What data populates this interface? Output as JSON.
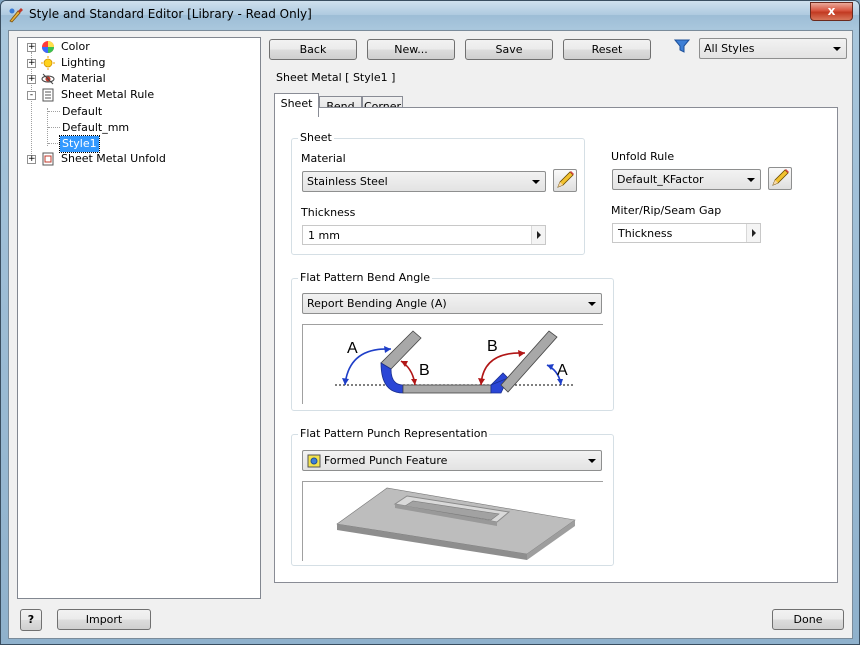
{
  "window": {
    "title": "Style and Standard Editor [Library - Read Only]",
    "close_label": "x"
  },
  "tree": {
    "items": [
      {
        "label": "Color",
        "expander": "+"
      },
      {
        "label": "Lighting",
        "expander": "+"
      },
      {
        "label": "Material",
        "expander": "+"
      },
      {
        "label": "Sheet Metal Rule",
        "expander": "-"
      },
      {
        "label": "Default"
      },
      {
        "label": "Default_mm"
      },
      {
        "label": "Style1"
      },
      {
        "label": "Sheet Metal Unfold",
        "expander": "+"
      }
    ]
  },
  "toolbar": {
    "back_label": "Back",
    "new_label": "New...",
    "save_label": "Save",
    "reset_label": "Reset",
    "filter_value": "All Styles"
  },
  "header": {
    "title": "Sheet Metal [ Style1 ]"
  },
  "tabs": [
    "Sheet",
    "Bend",
    "Corner"
  ],
  "sheet_group": {
    "title": "Sheet",
    "material_label": "Material",
    "material_value": "Stainless Steel",
    "thickness_label": "Thickness",
    "thickness_value": "1 mm"
  },
  "unfold": {
    "rule_label": "Unfold Rule",
    "rule_value": "Default_KFactor",
    "gap_label": "Miter/Rip/Seam Gap",
    "gap_value": "Thickness"
  },
  "bend_angle": {
    "title": "Flat Pattern Bend Angle",
    "value": "Report Bending Angle (A)",
    "diagram_labels": {
      "a": "A",
      "b": "B"
    }
  },
  "punch": {
    "title": "Flat Pattern Punch Representation",
    "value": "Formed Punch Feature"
  },
  "footer": {
    "help_label": "?",
    "import_label": "Import",
    "done_label": "Done"
  },
  "colors": {
    "selection": "#3399ff",
    "bend_blue": "#1f3fc8",
    "bend_red": "#b11616",
    "plate_gray": "#a8a8a8"
  }
}
